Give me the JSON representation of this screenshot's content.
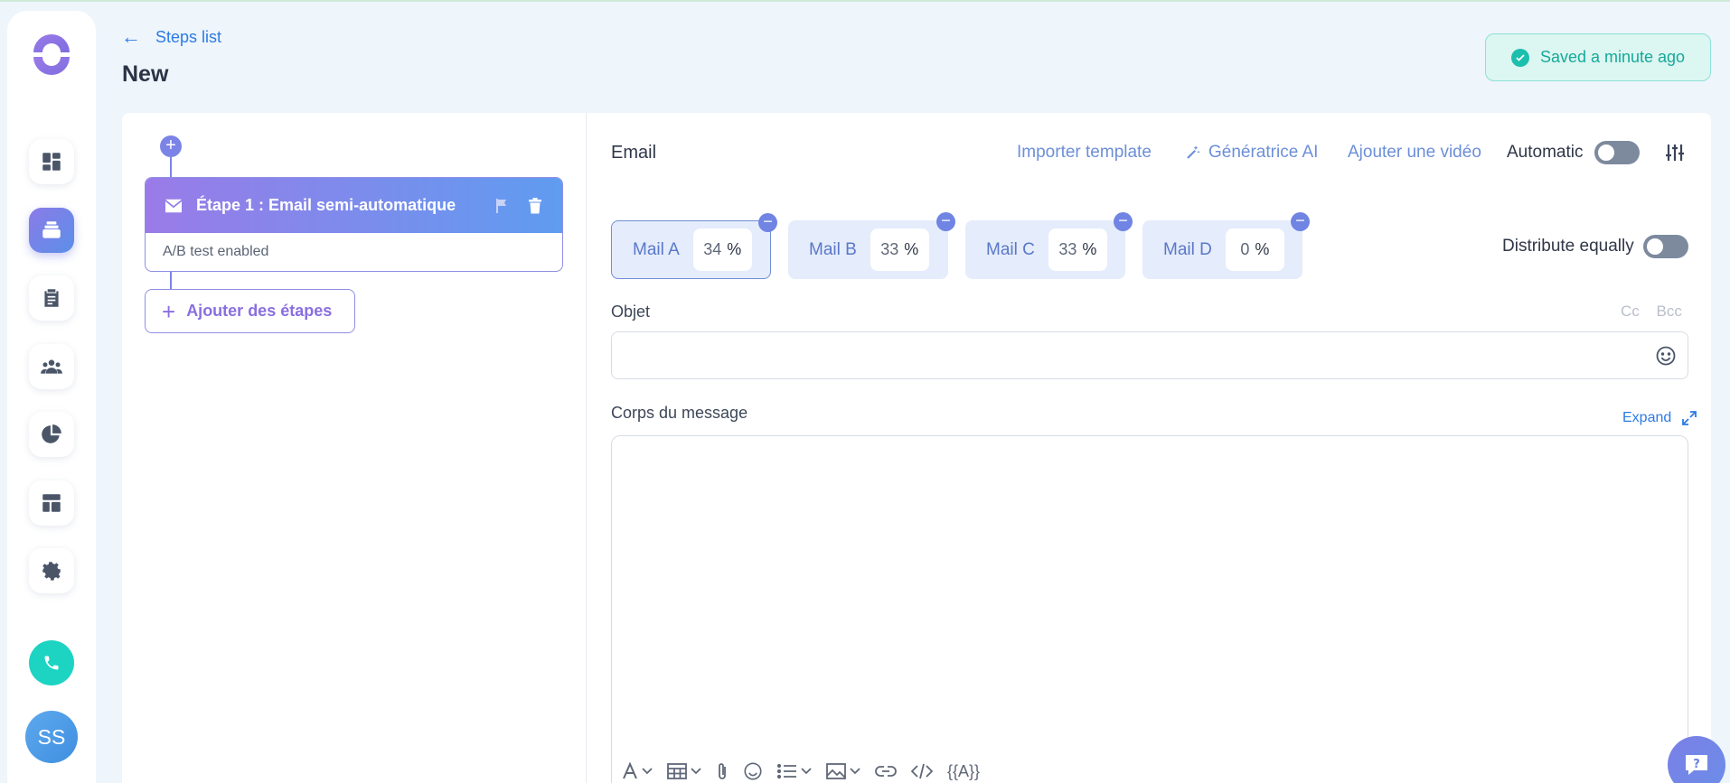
{
  "header": {
    "back_label": "Steps list",
    "page_title": "New",
    "saved_status": "Saved a minute ago"
  },
  "sidebar": {
    "items": [
      {
        "icon": "dashboard-icon",
        "active": false
      },
      {
        "icon": "stack-icon",
        "active": true
      },
      {
        "icon": "clipboard-icon",
        "active": false
      },
      {
        "icon": "people-icon",
        "active": false
      },
      {
        "icon": "pie-chart-icon",
        "active": false
      },
      {
        "icon": "layout-icon",
        "active": false
      },
      {
        "icon": "gear-icon",
        "active": false
      }
    ],
    "avatar_initials": "SS"
  },
  "steps": {
    "items": [
      {
        "title": "Étape 1 : Email semi-automatique",
        "subtitle": "A/B test enabled"
      }
    ],
    "add_label": "Ajouter des étapes"
  },
  "editor": {
    "section_label": "Email",
    "import_template": "Importer template",
    "ai_generator": "Génératrice AI",
    "add_video": "Ajouter une vidéo",
    "automatic_label": "Automatic",
    "distribute_label": "Distribute equally",
    "mails": [
      {
        "label": "Mail A",
        "percent": "34",
        "active": true
      },
      {
        "label": "Mail B",
        "percent": "33",
        "active": false
      },
      {
        "label": "Mail C",
        "percent": "33",
        "active": false
      },
      {
        "label": "Mail D",
        "percent": "0",
        "active": false
      }
    ],
    "percent_symbol": "%",
    "subject_label": "Objet",
    "subject_value": "",
    "cc_label": "Cc",
    "bcc_label": "Bcc",
    "body_label": "Corps du message",
    "expand_label": "Expand",
    "variable_token": "{{A}}"
  },
  "colors": {
    "accent": "#2c7be5",
    "brand_purple": "#8b7be8",
    "success": "#1cbfad",
    "phone": "#1dd4c3"
  }
}
